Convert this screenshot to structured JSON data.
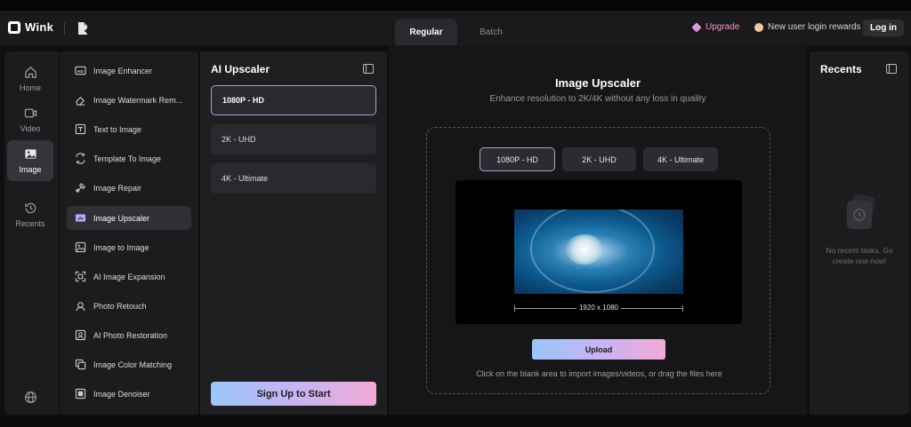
{
  "app": {
    "name": "Wink"
  },
  "header": {
    "tabs": [
      {
        "label": "Regular",
        "active": true
      },
      {
        "label": "Batch",
        "active": false
      }
    ],
    "upgrade_label": "Upgrade",
    "rewards_label": "New user login rewards",
    "login_label": "Log in"
  },
  "left_nav": {
    "items": [
      {
        "label": "Home",
        "icon": "home-icon",
        "active": false
      },
      {
        "label": "Video",
        "icon": "video-icon",
        "active": false
      },
      {
        "label": "Image",
        "icon": "image-icon",
        "active": true
      },
      {
        "label": "Recents",
        "icon": "history-icon",
        "active": false
      }
    ],
    "bottom_icon": "globe-icon"
  },
  "tools": {
    "items": [
      {
        "label": "Image Enhancer",
        "icon": "hd-icon"
      },
      {
        "label": "Image Watermark Rem...",
        "icon": "eraser-icon"
      },
      {
        "label": "Text to Image",
        "icon": "text-image-icon"
      },
      {
        "label": "Template To Image",
        "icon": "template-icon"
      },
      {
        "label": "Image Repair",
        "icon": "repair-icon"
      },
      {
        "label": "Image Upscaler",
        "icon": "upscale-icon",
        "active": true
      },
      {
        "label": "Image to Image",
        "icon": "image-to-image-icon"
      },
      {
        "label": "AI Image Expansion",
        "icon": "expand-icon"
      },
      {
        "label": "Photo Retouch",
        "icon": "retouch-icon"
      },
      {
        "label": "AI Photo Restoration",
        "icon": "restore-icon"
      },
      {
        "label": "Image Color Matching",
        "icon": "color-match-icon"
      },
      {
        "label": "Image Denoiser",
        "icon": "denoise-icon"
      }
    ]
  },
  "settings": {
    "title": "AI Upscaler",
    "options": [
      {
        "label": "1080P - HD",
        "selected": true
      },
      {
        "label": "2K - UHD",
        "selected": false
      },
      {
        "label": "4K - Ultimate",
        "selected": false
      }
    ],
    "cta_label": "Sign Up to Start"
  },
  "main": {
    "title": "Image Upscaler",
    "subtitle": "Enhance resolution to 2K/4K without any loss in quality",
    "quality_buttons": [
      {
        "label": "1080P - HD",
        "selected": true
      },
      {
        "label": "2K - UHD",
        "selected": false
      },
      {
        "label": "4K - Ultimate",
        "selected": false
      }
    ],
    "preview_dimension": "1920 x 1080",
    "upload_label": "Upload",
    "hint": "Click on the blank area to import images/videos, or drag the files here"
  },
  "recents": {
    "title": "Recents",
    "empty_text": "No recent tasks. Go create one now!"
  },
  "colors": {
    "accent_gradient": [
      "#9cc5f8",
      "#c6b4f4",
      "#f2a9d6"
    ],
    "selected_border": "#b89ad6",
    "upgrade": "#f49ac1"
  }
}
